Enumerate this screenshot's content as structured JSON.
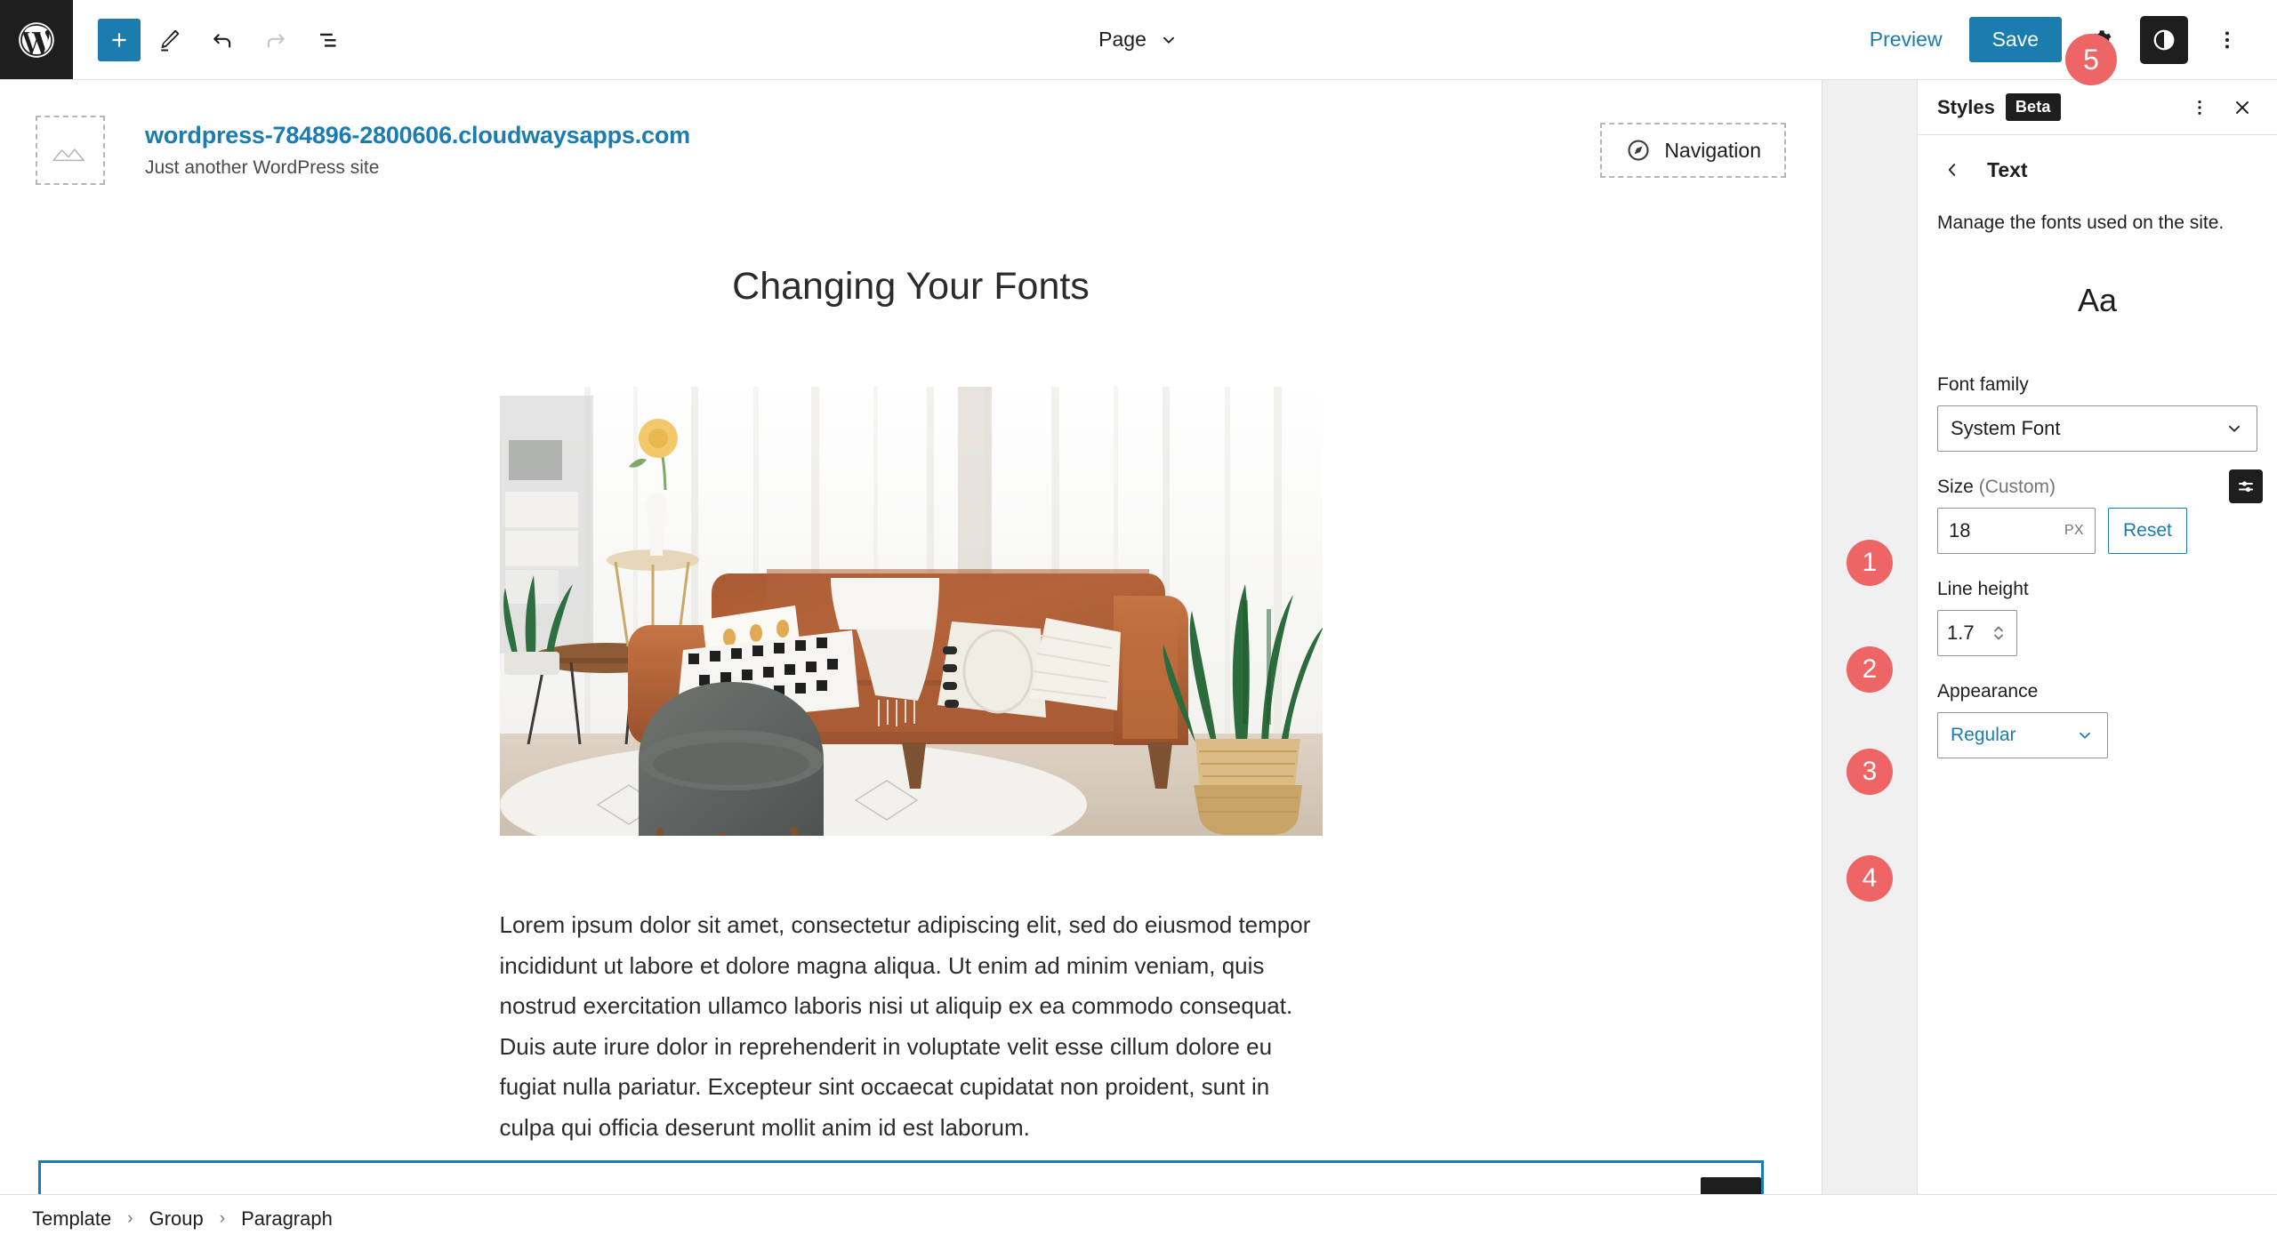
{
  "topbar": {
    "logo_icon": "wordpress-logo-icon",
    "add_block_icon": "plus-icon",
    "edit_icon": "pencil-icon",
    "undo_icon": "undo-icon",
    "redo_icon": "redo-icon",
    "list_view_icon": "list-view-icon",
    "document_type": "Page",
    "document_chevron_icon": "chevron-down-icon",
    "preview_label": "Preview",
    "save_label": "Save",
    "settings_icon": "gear-icon",
    "styles_icon": "contrast-styles-icon",
    "more_icon": "more-vertical-icon",
    "save_badge": "5"
  },
  "canvas": {
    "site": {
      "logo_placeholder_icon": "image-placeholder-icon",
      "title": "wordpress-784896-2800606.cloudwaysapps.com",
      "tagline": "Just another WordPress site",
      "nav_icon": "compass-navigation-icon",
      "nav_label": "Navigation"
    },
    "post": {
      "heading": "Changing Your Fonts",
      "image_alt": "living-room-brown-leather-sofa",
      "paragraph": "Lorem ipsum dolor sit amet, consectetur adipiscing elit, sed do eiusmod tempor incididunt ut labore et dolore magna aliqua. Ut enim ad minim veniam, quis nostrud exercitation ullamco laboris nisi ut aliquip ex ea commodo consequat. Duis aute irure dolor in reprehenderit in voluptate velit esse cillum dolore eu fugiat nulla pariatur. Excepteur sint occaecat cupidatat non proident, sunt in culpa qui officia deserunt mollit anim id est laborum."
    }
  },
  "sidebar": {
    "title": "Styles",
    "beta_label": "Beta",
    "more_icon": "more-vertical-icon",
    "close_icon": "close-icon",
    "back_icon": "chevron-left-icon",
    "section_title": "Text",
    "description": "Manage the fonts used on the site.",
    "font_preview": "Aa",
    "font_family": {
      "label": "Font family",
      "value": "System Font",
      "chevron_icon": "chevron-down-icon",
      "badge": "1"
    },
    "size": {
      "label": "Size",
      "label_suffix": "(Custom)",
      "value": "18",
      "unit": "PX",
      "reset_label": "Reset",
      "sliders_icon": "sliders-toggle-icon",
      "badge": "2"
    },
    "line_height": {
      "label": "Line height",
      "value": "1.7",
      "spinner_icon": "stepper-arrows-icon",
      "badge": "3"
    },
    "appearance": {
      "label": "Appearance",
      "value": "Regular",
      "chevron_icon": "chevron-down-icon",
      "badge": "4"
    }
  },
  "footer": {
    "breadcrumb": [
      {
        "label": "Template"
      },
      {
        "label": "Group"
      },
      {
        "label": "Paragraph"
      }
    ],
    "separator": "›"
  },
  "colors": {
    "accent": "#1a7caf",
    "badge": "#ee6565",
    "dark": "#1e1e1e",
    "border": "#e0e0e0"
  }
}
